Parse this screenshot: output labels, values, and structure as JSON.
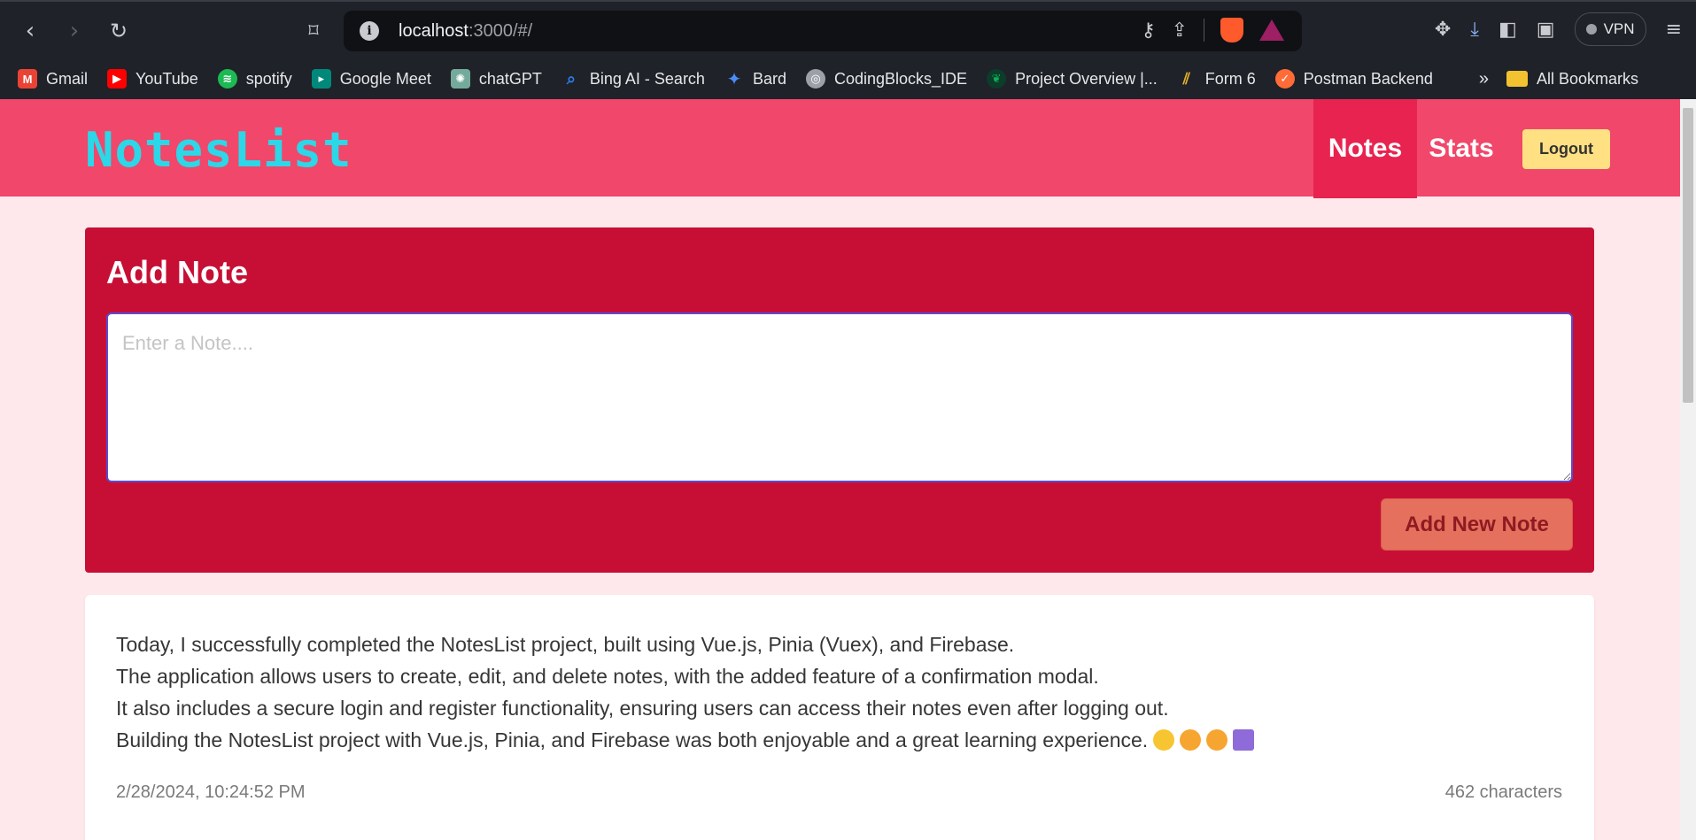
{
  "browser": {
    "url_host": "localhost",
    "url_path": ":3000/#/",
    "vpn_label": "VPN",
    "bookmarks": [
      {
        "label": "Gmail",
        "icon": "gmail-icon",
        "color": "#ea4335"
      },
      {
        "label": "YouTube",
        "icon": "youtube-icon",
        "color": "#ff0000"
      },
      {
        "label": "spotify",
        "icon": "spotify-icon",
        "color": "#1db954"
      },
      {
        "label": "Google Meet",
        "icon": "google-meet-icon",
        "color": "#00897b"
      },
      {
        "label": "chatGPT",
        "icon": "chatgpt-icon",
        "color": "#74aa9c"
      },
      {
        "label": "Bing AI - Search",
        "icon": "search-icon",
        "color": "#2b7de9"
      },
      {
        "label": "Bard",
        "icon": "bard-icon",
        "color": "#4b8df8"
      },
      {
        "label": "CodingBlocks_IDE",
        "icon": "globe-icon",
        "color": "#9da0a7"
      },
      {
        "label": "Project Overview |...",
        "icon": "mongodb-icon",
        "color": "#13aa52"
      },
      {
        "label": "Form 6",
        "icon": "form-icon",
        "color": "#e9b22b"
      },
      {
        "label": "Postman Backend",
        "icon": "postman-icon",
        "color": "#ff6c37"
      }
    ],
    "more_label": "»",
    "all_bookmarks_label": "All Bookmarks"
  },
  "app": {
    "logo": "NotesList",
    "nav": {
      "notes": "Notes",
      "stats": "Stats"
    },
    "logout_label": "Logout",
    "add_note": {
      "title": "Add Note",
      "placeholder": "Enter a Note....",
      "button_label": "Add New Note"
    },
    "notes": [
      {
        "lines": [
          "Today, I successfully completed the NotesList project, built using Vue.js, Pinia (Vuex), and Firebase.",
          "The application allows users to create, edit, and delete notes, with the added feature of a confirmation modal.",
          "It also includes a secure login and register functionality, ensuring users can access their notes even after logging out.",
          "Building the NotesList project with Vue.js, Pinia, and Firebase was both enjoyable and a great learning experience."
        ],
        "date": "2/28/2024, 10:24:52 PM",
        "char_count": "462 characters"
      }
    ]
  },
  "colors": {
    "header": "#f0476a",
    "nav_active": "#e8234f",
    "add_card": "#c70f35",
    "logo": "#2cd7e8",
    "logout": "#ffe082",
    "add_button": "#e6705e",
    "page_bg": "#ffe8ec"
  }
}
